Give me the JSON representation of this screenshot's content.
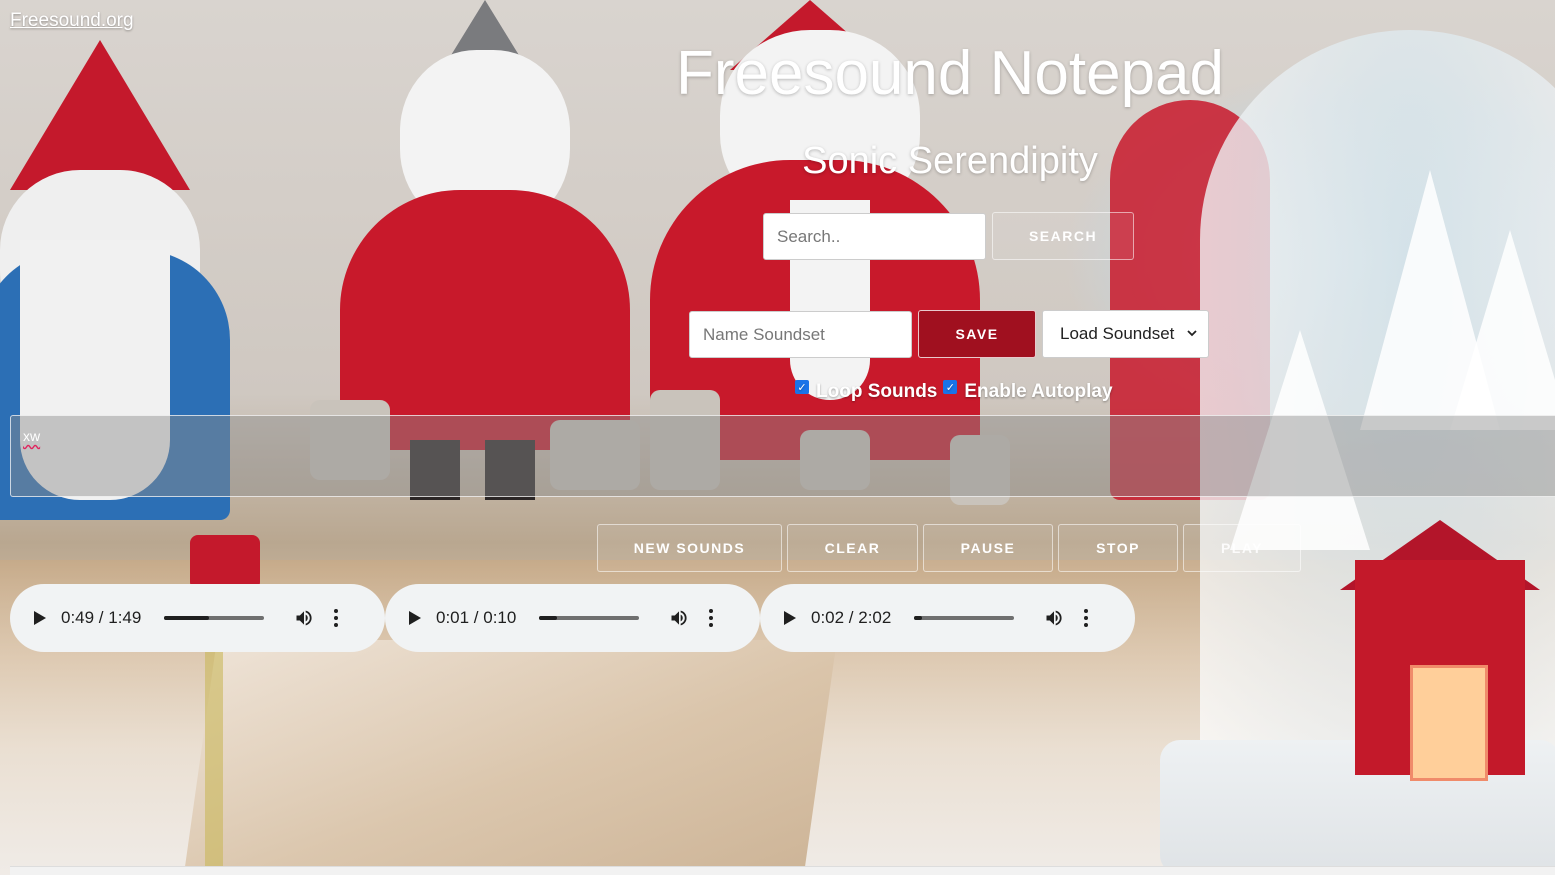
{
  "header": {
    "site_link": "Freesound.org",
    "title": "Freesound Notepad",
    "subtitle": "Sonic Serendipity"
  },
  "search": {
    "placeholder": "Search..",
    "value": "",
    "button_label": "SEARCH"
  },
  "soundset": {
    "name_placeholder": "Name Soundset",
    "name_value": "",
    "save_label": "SAVE",
    "load_selected": "Load Soundset"
  },
  "options": {
    "loop_label": "Loop Sounds",
    "loop_checked": true,
    "autoplay_label": "Enable Autoplay",
    "autoplay_checked": true
  },
  "notepad": {
    "text": "xw"
  },
  "controls": {
    "new_sounds": "NEW SOUNDS",
    "clear": "CLEAR",
    "pause": "PAUSE",
    "stop": "STOP",
    "play": "PLAY"
  },
  "players": [
    {
      "time": "0:49 / 1:49",
      "progress": 0.45
    },
    {
      "time": "0:01 / 0:10",
      "progress": 0.18
    },
    {
      "time": "0:02 / 2:02",
      "progress": 0.08
    }
  ],
  "icons": {
    "play": "play-icon",
    "volume": "volume-icon",
    "more": "more-options-icon",
    "dropdown": "chevron-down-icon"
  },
  "colors": {
    "save_bg": "#a0101f",
    "checkbox": "#1a73e8",
    "player_bg": "#f1f3f4"
  }
}
